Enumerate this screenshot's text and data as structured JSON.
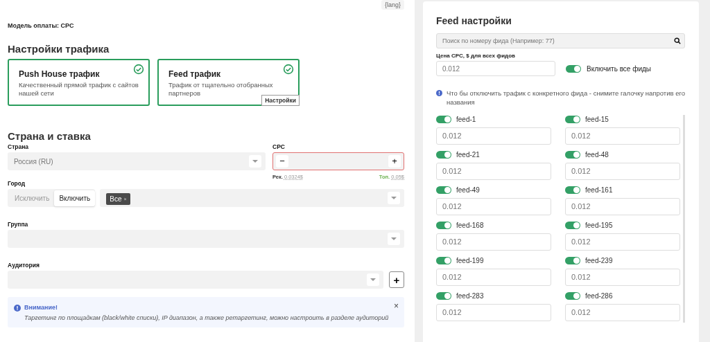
{
  "lang_badge": "{lang}",
  "payment_model": {
    "label": "Модель оплаты:",
    "value": "CPC"
  },
  "traffic": {
    "title": "Настройки трафика",
    "cards": [
      {
        "title": "Push House трафик",
        "description": "Качественный прямой трафик с сайтов нашей сети",
        "checked": true
      },
      {
        "title": "Feed трафик",
        "description": "Трафик от тщательно отобранных партнеров",
        "checked": true,
        "settings_button": "Настройки"
      }
    ]
  },
  "country_rate": {
    "title": "Страна и ставка",
    "country": {
      "label": "Страна",
      "value": "Россия (RU)"
    },
    "cpc": {
      "label": "CPC",
      "minus": "−",
      "plus": "+",
      "error": true,
      "recommended_label": "Рек.",
      "recommended_value": "0.0324$",
      "top_label": "Топ.",
      "top_value": "0.05$"
    },
    "city": {
      "label": "Город",
      "modes": [
        {
          "label": "Исключить",
          "selected": false
        },
        {
          "label": "Включить",
          "selected": true
        }
      ],
      "tags": [
        {
          "label": "Все",
          "remove": "×"
        }
      ]
    },
    "group": {
      "label": "Группа"
    },
    "audience": {
      "label": "Аудитория",
      "add": "+"
    }
  },
  "alert": {
    "title": "Внимание!",
    "text": "Таргетинг по площадкам (black/white списки), IP диапазон, а также ретаргетинг, можно настроить в разделе аудиторий",
    "close": "×"
  },
  "feed_settings": {
    "title": "Feed настройки",
    "search_placeholder": "Поиск по номеру фида (Например: 77)",
    "price_label": "Цена CPC, $ для всех фидов",
    "price_placeholder": "0.012",
    "enable_all": {
      "label": "Включить все фиды",
      "on": true
    },
    "info": "Что бы отключить трафик с конкретного фида - снимите галочку напротив его названия",
    "feeds": [
      {
        "name": "feed-1",
        "on": true,
        "placeholder": "0.012"
      },
      {
        "name": "feed-15",
        "on": true,
        "placeholder": "0.012"
      },
      {
        "name": "feed-21",
        "on": true,
        "placeholder": "0.012"
      },
      {
        "name": "feed-48",
        "on": true,
        "placeholder": "0.012"
      },
      {
        "name": "feed-49",
        "on": true,
        "placeholder": "0.012"
      },
      {
        "name": "feed-161",
        "on": true,
        "placeholder": "0.012"
      },
      {
        "name": "feed-168",
        "on": true,
        "placeholder": "0.012"
      },
      {
        "name": "feed-195",
        "on": true,
        "placeholder": "0.012"
      },
      {
        "name": "feed-199",
        "on": true,
        "placeholder": "0.012"
      },
      {
        "name": "feed-239",
        "on": true,
        "placeholder": "0.012"
      },
      {
        "name": "feed-283",
        "on": true,
        "placeholder": "0.012"
      },
      {
        "name": "feed-286",
        "on": true,
        "placeholder": "0.012"
      }
    ]
  }
}
